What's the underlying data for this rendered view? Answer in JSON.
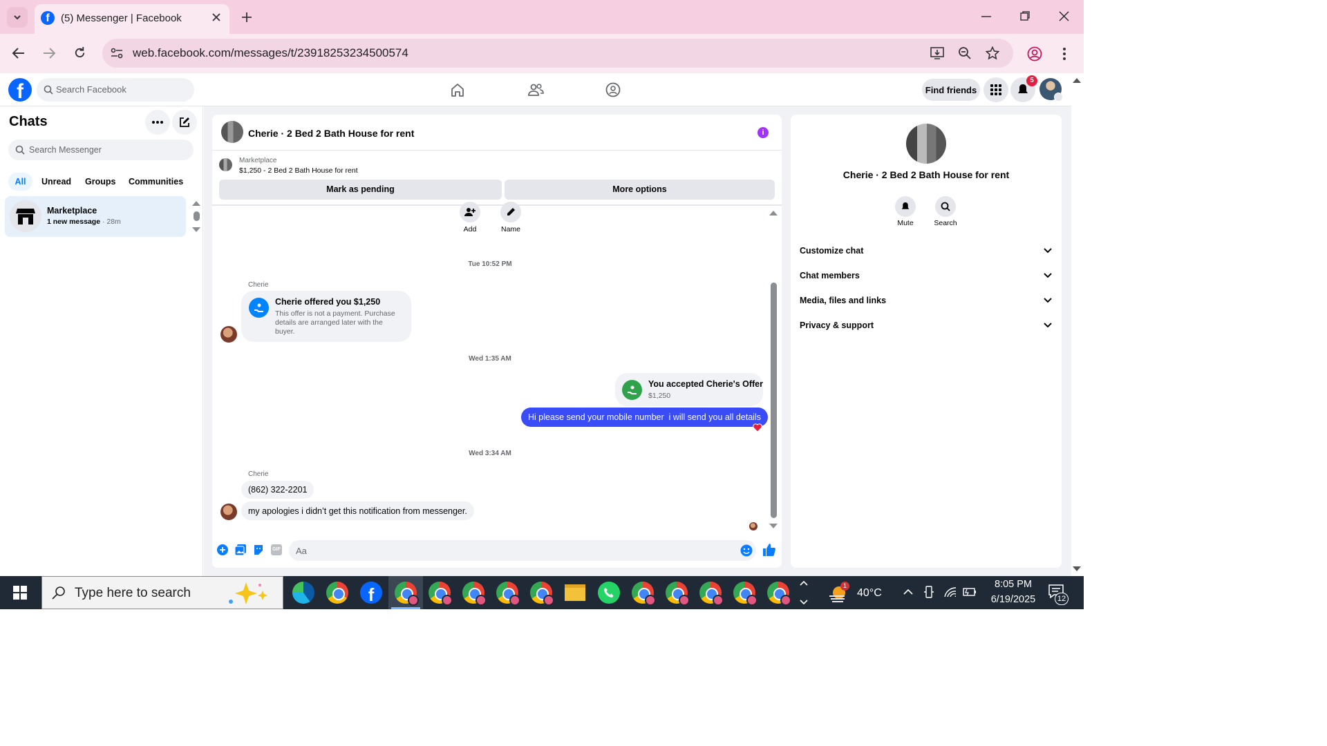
{
  "browser": {
    "tab_title": "(5) Messenger | Facebook",
    "url": "web.facebook.com/messages/t/23918253234500574"
  },
  "fb_header": {
    "search_placeholder": "Search Facebook",
    "find_friends": "Find friends",
    "notification_count": "5"
  },
  "chats": {
    "title": "Chats",
    "search_placeholder": "Search Messenger",
    "filters": [
      "All",
      "Unread",
      "Groups",
      "Communities"
    ],
    "items": [
      {
        "name": "Marketplace",
        "preview": "1 new message",
        "time": "28m"
      }
    ]
  },
  "conversation": {
    "title": "Cherie · 2 Bed 2 Bath House for rent",
    "listing": {
      "label": "Marketplace",
      "detail": "$1,250 - 2 Bed 2 Bath House for rent"
    },
    "mark_pending": "Mark as pending",
    "more_options": "More options",
    "actions": {
      "add": "Add",
      "name": "Name"
    },
    "messages": {
      "ts1": "Tue 10:52 PM",
      "sender1": "Cherie",
      "offer_title": "Cherie offered you $1,250",
      "offer_body": "This offer is not a payment. Purchase details are arranged later with the buyer.",
      "ts2": "Wed 1:35 AM",
      "accepted_title": "You accepted Cherie's Offer",
      "accepted_amount": "$1,250",
      "my_msg": "Hi please send your mobile number  i will send you all details",
      "ts3": "Wed 3:34 AM",
      "sender2": "Cherie",
      "phone": "(862) 322-2201",
      "reply": "my apologies i didn’t get this notification from messenger."
    },
    "composer_placeholder": "Aa"
  },
  "info_panel": {
    "name": "Cherie · 2 Bed 2 Bath House for rent",
    "mute": "Mute",
    "search": "Search",
    "sections": [
      "Customize chat",
      "Chat members",
      "Media, files and links",
      "Privacy & support"
    ]
  },
  "taskbar": {
    "search_placeholder": "Type here to search",
    "temperature": "40°C",
    "weather_badge": "1",
    "time": "8:05 PM",
    "date": "6/19/2025",
    "notification_count": "12"
  },
  "colors": {
    "accent": "#0a7cff",
    "messenger_blue": "#0084ff",
    "info_purple": "#a033ff",
    "offer_green": "#31a24c",
    "tab_pink": "#f6cfe0"
  }
}
